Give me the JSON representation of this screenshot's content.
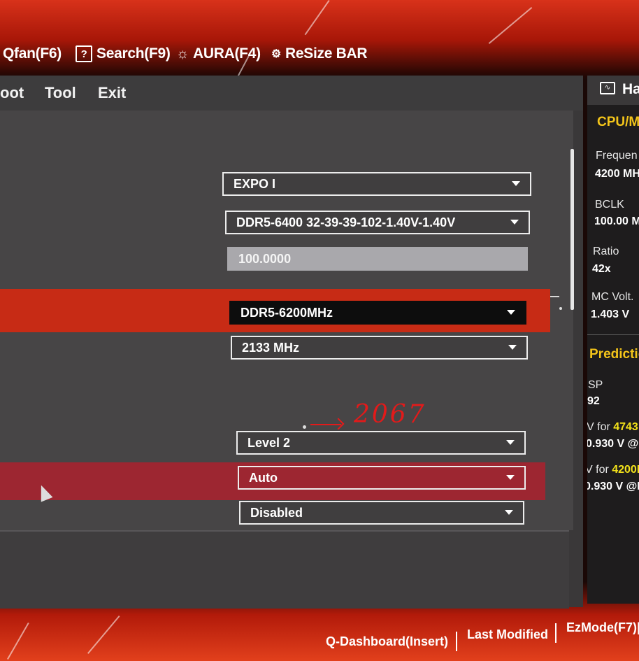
{
  "toolbar": {
    "qfan": "Qfan(F6)",
    "search": "Search(F9)",
    "search_icon_glyph": "?",
    "aura": "AURA(F4)",
    "resize_bar": "ReSize BAR"
  },
  "menu": {
    "boot": "oot",
    "tool": "Tool",
    "exit": "Exit"
  },
  "settings": [
    {
      "value": "EXPO I"
    },
    {
      "value": "DDR5-6400 32-39-39-102-1.40V-1.40V"
    },
    {
      "value": "100.0000"
    },
    {
      "value": "DDR5-6200MHz"
    },
    {
      "value": "2133 MHz"
    },
    {
      "value": "Level 2"
    },
    {
      "value": "Auto"
    },
    {
      "value": "Disabled"
    }
  ],
  "annotation": "2067",
  "hardware_monitor": {
    "title": "Ha",
    "cpu_section": "CPU/M",
    "frequency_label": "Frequen",
    "frequency_value": "4200 MH",
    "bclk_label": "BCLK",
    "bclk_value": "100.00 M",
    "ratio_label": "Ratio",
    "ratio_value": "42x",
    "mc_volt_label": "MC Volt.",
    "mc_volt_value": "1.403 V",
    "prediction_section": "Predictio",
    "sp_label": "SP",
    "sp_value": "92",
    "vfor1_label": "V for ",
    "vfor1_freq": "4743",
    "vfor1_value": "0.930 V @L",
    "vfor2_label": "V for ",
    "vfor2_freq": "4200M",
    "vfor2_value": "0.930 V @LS"
  },
  "footer": {
    "qdashboard": "Q-Dashboard(Insert)",
    "last_modified": "Last Modified",
    "ezmode": "EzMode(F7)|-"
  },
  "colors": {
    "accent_red": "#c72b15",
    "highlight_rose": "#9d2631",
    "section_yellow": "#f3c41a"
  }
}
